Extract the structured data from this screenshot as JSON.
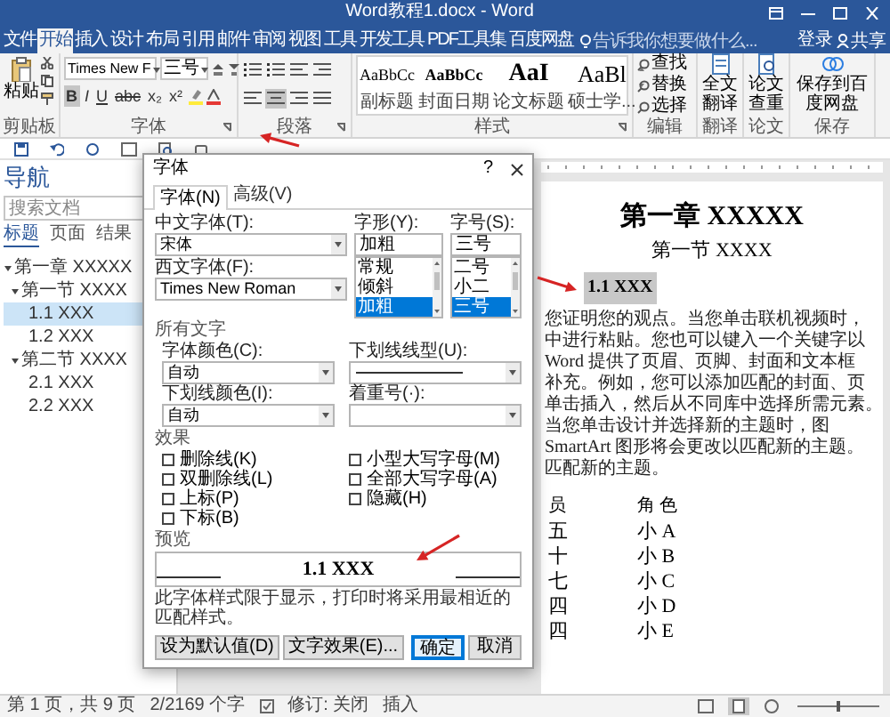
{
  "window": {
    "title": "Word教程1.docx - Word"
  },
  "ribbon_tabs": [
    {
      "label": "文件",
      "selected": false
    },
    {
      "label": "开始",
      "selected": true
    },
    {
      "label": "插入",
      "selected": false
    },
    {
      "label": "设计",
      "selected": false
    },
    {
      "label": "布局",
      "selected": false
    },
    {
      "label": "引用",
      "selected": false
    },
    {
      "label": "邮件",
      "selected": false
    },
    {
      "label": "审阅",
      "selected": false
    },
    {
      "label": "视图",
      "selected": false
    },
    {
      "label": "工具",
      "selected": false
    },
    {
      "label": "开发工具",
      "selected": false
    },
    {
      "label": "PDF工具集",
      "selected": false
    },
    {
      "label": "百度网盘",
      "selected": false
    }
  ],
  "tell_me": {
    "placeholder": "告诉我你想要做什么..."
  },
  "account": {
    "sign_in": "登录",
    "share": "共享"
  },
  "ribbon": {
    "clipboard": {
      "paste": "粘贴",
      "group": "剪贴板"
    },
    "font": {
      "font_name": "Times New F",
      "font_size": "三号",
      "format_buttons": [
        "B",
        "I",
        "U",
        "abc",
        "x₂",
        "x²"
      ],
      "group": "字体"
    },
    "paragraph": {
      "group": "段落"
    },
    "styles": {
      "items": [
        {
          "preview": "AaBbCc",
          "name": "副标题"
        },
        {
          "preview": "AaBbCc",
          "name": "封面日期"
        },
        {
          "preview": "AaI",
          "name": "论文标题"
        },
        {
          "preview": "AaBl",
          "name": "硕士学..."
        }
      ],
      "group": "样式"
    },
    "editing": {
      "items": [
        "查找",
        "替换",
        "选择"
      ],
      "group": "编辑"
    },
    "big_buttons": [
      {
        "label": "全文翻译",
        "group": "翻译"
      },
      {
        "label": "论文查重",
        "group": "论文"
      },
      {
        "label": "保存到百度网盘",
        "group": "保存"
      }
    ]
  },
  "navigation": {
    "title": "导航",
    "search": {
      "placeholder": "搜索文档"
    },
    "tabs": [
      {
        "label": "标题",
        "selected": true
      },
      {
        "label": "页面",
        "selected": false
      },
      {
        "label": "结果",
        "selected": false
      }
    ],
    "tree": [
      {
        "label": "第一章 XXXXX",
        "expanded": true,
        "selected": false,
        "children": [
          {
            "label": "第一节 XXXX",
            "expanded": true,
            "selected": false,
            "children": [
              {
                "label": "1.1 XXX",
                "selected": true
              },
              {
                "label": "1.2 XXX",
                "selected": false
              }
            ]
          },
          {
            "label": "第二节 XXXX",
            "expanded": true,
            "selected": false,
            "children": [
              {
                "label": "2.1 XXX",
                "selected": false
              },
              {
                "label": "2.2 XXX",
                "selected": false
              }
            ]
          }
        ]
      }
    ]
  },
  "document": {
    "heading_1": "第一章  XXXXX",
    "heading_2": "第一节  XXXX",
    "heading_3": {
      "text": "1.1 XXX",
      "selected": true
    },
    "paragraph_lines": [
      "您证明您的观点。当您单击联机视频时，",
      "中进行粘贴。您也可以键入一个关键字以",
      "Word 提供了页眉、页脚、封面和文本框",
      "补充。例如，您可以添加匹配的封面、页",
      "单击插入，然后从不同库中选择所需元素。",
      "当您单击设计并选择新的主题时，图",
      "SmartArt 图形将会更改以匹配新的主题。",
      "匹配新的主题。"
    ],
    "table": {
      "columns": [
        "员",
        "角  色"
      ],
      "rows": [
        [
          "五",
          "小  A"
        ],
        [
          "十",
          "小  B"
        ],
        [
          "七",
          "小  C"
        ],
        [
          "四",
          "小  D"
        ],
        [
          "四",
          "小  E"
        ]
      ]
    }
  },
  "font_dialog": {
    "title": "字体",
    "help": "?",
    "tabs": [
      {
        "label": "字体(N)",
        "selected": true
      },
      {
        "label": "高级(V)",
        "selected": false
      }
    ],
    "chinese_font": {
      "label": "中文字体(T):",
      "value": "宋体"
    },
    "font_style": {
      "label": "字形(Y):",
      "value": "加粗",
      "options": [
        {
          "label": "常规",
          "selected": false
        },
        {
          "label": "倾斜",
          "selected": false
        },
        {
          "label": "加粗",
          "selected": true
        }
      ]
    },
    "font_size": {
      "label": "字号(S):",
      "value": "三号",
      "options": [
        {
          "label": "二号",
          "selected": false
        },
        {
          "label": "小二",
          "selected": false
        },
        {
          "label": "三号",
          "selected": true
        }
      ]
    },
    "western_font": {
      "label": "西文字体(F):",
      "value": "Times New Roman"
    },
    "all_text": {
      "title": "所有文字",
      "fields": [
        {
          "label": "字体颜色(C):",
          "kind": "text",
          "value": "自动"
        },
        {
          "label": "下划线线型(U):",
          "kind": "line"
        },
        {
          "label": "下划线颜色(I):",
          "kind": "text",
          "value": "自动"
        },
        {
          "label": "着重号(·):",
          "kind": "text"
        }
      ]
    },
    "effects": {
      "title": "效果",
      "left": [
        {
          "label": "删除线(K)",
          "checked": false
        },
        {
          "label": "双删除线(L)",
          "checked": false
        },
        {
          "label": "上标(P)",
          "checked": false
        },
        {
          "label": "下标(B)",
          "checked": false
        }
      ],
      "right": [
        {
          "label": "小型大写字母(M)",
          "checked": false
        },
        {
          "label": "全部大写字母(A)",
          "checked": false
        },
        {
          "label": "隐藏(H)",
          "checked": false
        }
      ]
    },
    "preview": {
      "title": "预览",
      "sample": "1.1 XXX",
      "note": "此字体样式限于显示，打印时将采用最相近的匹配样式。"
    },
    "buttons": [
      {
        "label": "设为默认值(D)",
        "kind": "plain"
      },
      {
        "label": "文字效果(E)...",
        "kind": "plain"
      },
      {
        "label": "确定",
        "kind": "default"
      },
      {
        "label": "取消",
        "kind": "plain"
      }
    ]
  },
  "status_bar": {
    "items": [
      "第 1 页，共 9 页",
      "2/2169 个字",
      "修订: 关闭",
      "插入"
    ]
  }
}
